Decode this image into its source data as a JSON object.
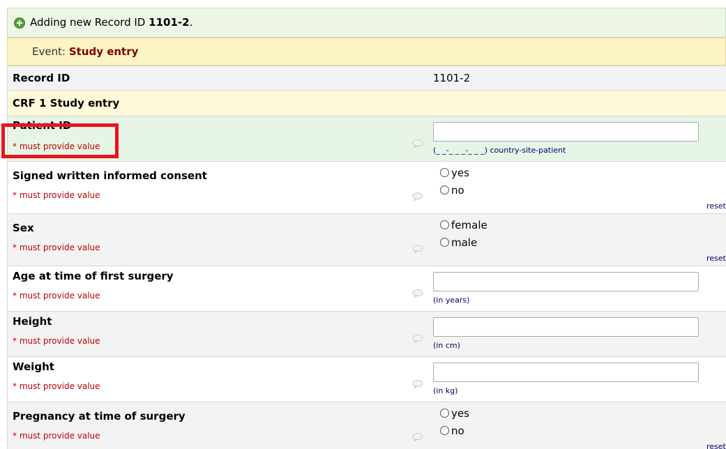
{
  "header": {
    "prefix": "Adding new Record ID",
    "record_id": "1101-2",
    "suffix": "."
  },
  "event": {
    "label": "Event:",
    "name": "Study entry"
  },
  "record_row": {
    "label": "Record ID",
    "value": "1101-2"
  },
  "section": {
    "title": "CRF 1 Study entry"
  },
  "required_text": "* must provide value",
  "reset_label": "reset",
  "fields": {
    "patient_id": {
      "label": "Patient ID",
      "value": "",
      "note": "(_ _-_ _ _-_ _ _) country-site-patient"
    },
    "consent": {
      "label": "Signed written informed consent",
      "options": [
        "yes",
        "no"
      ]
    },
    "sex": {
      "label": "Sex",
      "options": [
        "female",
        "male"
      ]
    },
    "age": {
      "label": "Age at time of first surgery",
      "value": "",
      "note": "(in years)"
    },
    "height": {
      "label": "Height",
      "value": "",
      "note": "(in cm)"
    },
    "weight": {
      "label": "Weight",
      "value": "",
      "note": "(in kg)"
    },
    "pregnancy": {
      "label": "Pregnancy at time of surgery",
      "options": [
        "yes",
        "no"
      ]
    }
  },
  "colors": {
    "header_bg": "#edf5e6",
    "event_bg": "#fcf4c4",
    "event_name": "#800000",
    "section_bg": "#fffad9",
    "focus_row_bg": "#e6f5e6",
    "required": "#c00000",
    "highlight_box": "#e8141e"
  }
}
